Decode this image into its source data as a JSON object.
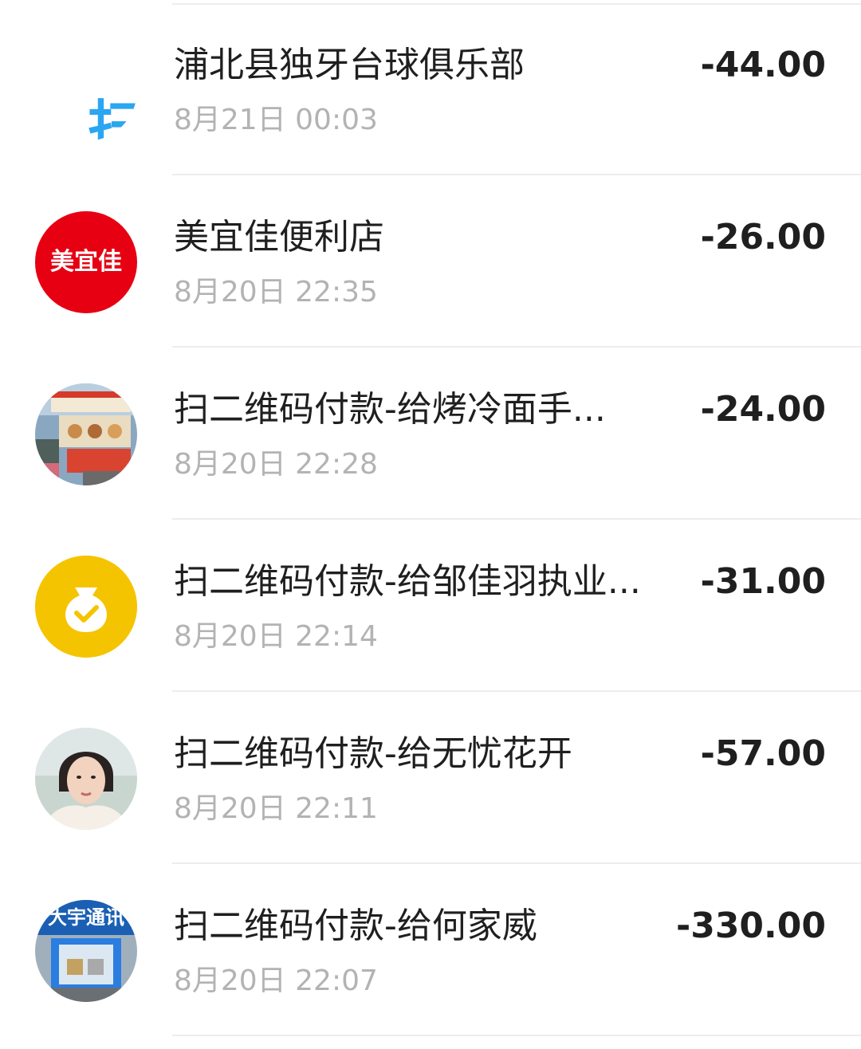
{
  "transactions": [
    {
      "avatar": "scan-icon",
      "avatar_text": "扫",
      "title": "浦北县独牙台球俱乐部",
      "time": "8月21日 00:03",
      "amount": "-44.00"
    },
    {
      "avatar": "meiyijia-logo",
      "avatar_text": "美宜佳",
      "avatar_color": "#e60012",
      "title": "美宜佳便利店",
      "time": "8月20日 22:35",
      "amount": "-26.00"
    },
    {
      "avatar": "shop-photo-avatar",
      "title": "扫二维码付款-给烤冷面手...",
      "time": "8月20日 22:28",
      "amount": "-24.00"
    },
    {
      "avatar": "money-bag-icon",
      "avatar_color": "#f5c400",
      "title": "扫二维码付款-给邹佳羽执业...",
      "time": "8月20日 22:14",
      "amount": "-31.00"
    },
    {
      "avatar": "person-photo-avatar",
      "title": "扫二维码付款-给无忧花开",
      "time": "8月20日 22:11",
      "amount": "-57.00"
    },
    {
      "avatar": "store-photo-avatar",
      "avatar_text": "大宇通讯",
      "title": "扫二维码付款-给何家威",
      "time": "8月20日 22:07",
      "amount": "-330.00"
    }
  ],
  "colors": {
    "scan_blue": "#2ba6f0",
    "meiyijia_red": "#e60012",
    "bag_yellow": "#f5c400",
    "title_text": "#1f1f1f",
    "time_text": "#b3b3b3"
  }
}
